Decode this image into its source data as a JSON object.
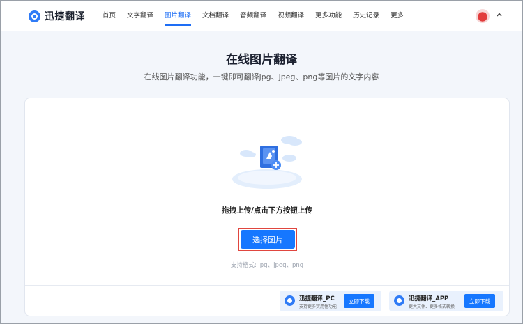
{
  "header": {
    "logo_text": "迅捷翻译",
    "nav": [
      "首页",
      "文字翻译",
      "图片翻译",
      "文档翻译",
      "音频翻译",
      "视频翻译",
      "更多功能",
      "历史记录",
      "更多"
    ],
    "active_index": 2,
    "caret": "^"
  },
  "main": {
    "title": "在线图片翻译",
    "subtitle": "在线图片翻译功能，一键即可翻译jpg、jpeg、png等图片的文字内容",
    "drag_text": "拖拽上传/点击下方按钮上传",
    "select_button": "选择图片",
    "formats": "支持格式: jpg、jpeg、png"
  },
  "downloads": [
    {
      "name": "迅捷翻译_PC",
      "desc": "支持更多实用性功能",
      "button": "立即下载"
    },
    {
      "name": "迅捷翻译_APP",
      "desc": "更大文件、更多格式转换",
      "button": "立即下载"
    }
  ],
  "colors": {
    "accent": "#1677ff",
    "highlight_border": "#e0463f"
  }
}
